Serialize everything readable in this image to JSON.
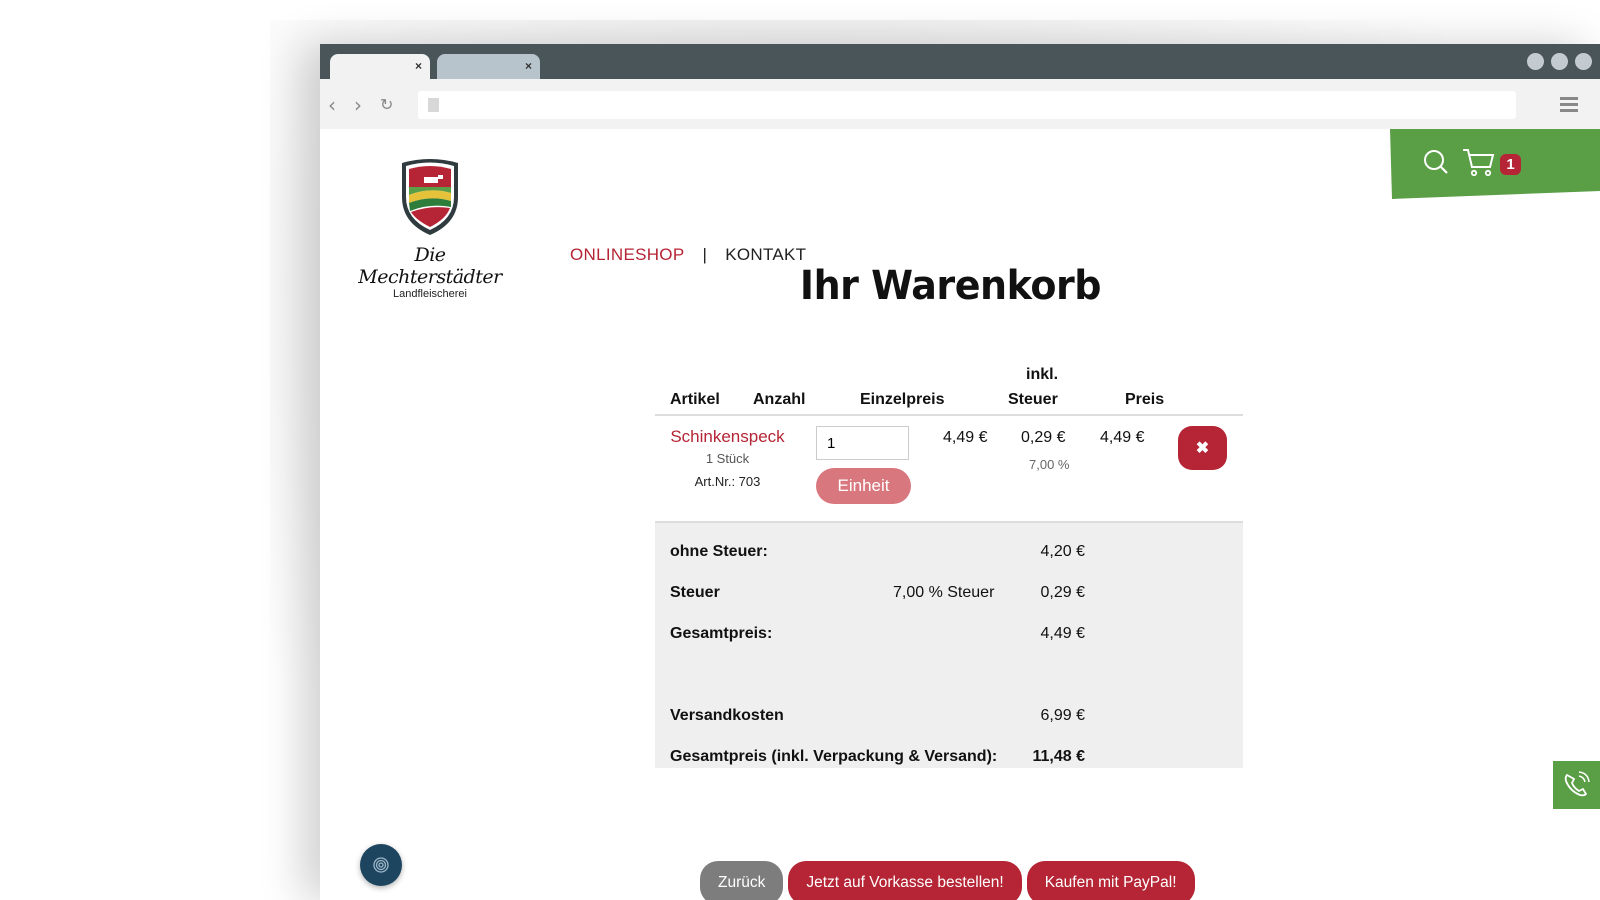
{
  "browser": {
    "tab_close_glyph": "×"
  },
  "logo": {
    "name": "Die Mechterstädter",
    "subtitle": "Landfleischerei"
  },
  "nav": {
    "onlineshop": "ONLINESHOP",
    "separator": "|",
    "kontakt": "KONTAKT"
  },
  "cart_widget": {
    "count": "1",
    "icons": [
      "search-icon",
      "cart-icon"
    ],
    "color": "#5a9e46"
  },
  "page_title": "Ihr Warenkorb",
  "table": {
    "headers": {
      "artikel": "Artikel",
      "anzahl": "Anzahl",
      "einzelpreis": "Einzelpreis",
      "steuer_line1": "inkl.",
      "steuer_line2": "Steuer",
      "preis": "Preis"
    },
    "items": [
      {
        "name": "Schinkenspeck",
        "unit": "1 Stück",
        "art_nr": "Art.Nr.: 703",
        "quantity": "1",
        "unit_button": "Einheit",
        "einzelpreis": "4,49 €",
        "steuer": "0,29 €",
        "steuer_rate": "7,00 %",
        "preis": "4,49 €",
        "delete_glyph": "✖"
      }
    ]
  },
  "totals": {
    "ohne_steuer_label": "ohne Steuer:",
    "ohne_steuer_value": "4,20 €",
    "steuer_label": "Steuer",
    "steuer_rate_text": "7,00 % Steuer",
    "steuer_value": "0,29 €",
    "gesamt_label": "Gesamtpreis:",
    "gesamt_value": "4,49 €",
    "versand_label": "Versandkosten",
    "versand_value": "6,99 €",
    "endpreis_label": "Gesamtpreis (inkl. Verpackung & Versand):",
    "endpreis_value": "11,48 €"
  },
  "actions": {
    "back": "Zurück",
    "vorkasse": "Jetzt auf Vorkasse bestellen!",
    "paypal": "Kaufen mit PayPal!"
  },
  "colors": {
    "brand_red": "#b52535",
    "brand_green": "#5a9e46",
    "title_bar": "#4a555a"
  }
}
